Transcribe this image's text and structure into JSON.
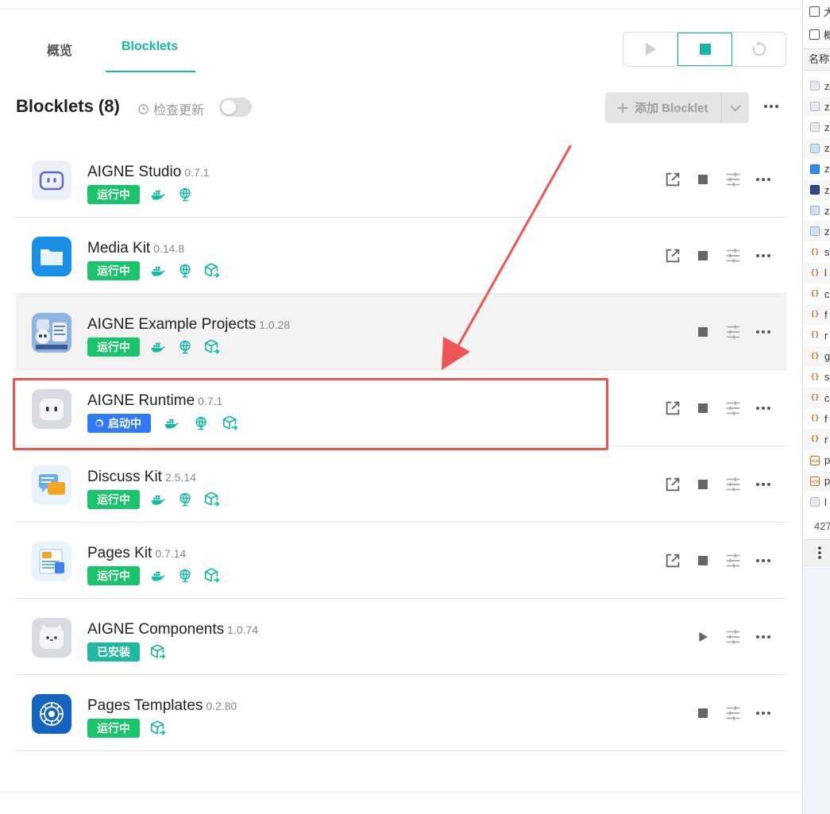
{
  "tabs": [
    {
      "label": "概览",
      "active": false
    },
    {
      "label": "Blocklets",
      "active": true
    }
  ],
  "header": {
    "title": "Blocklets (8)",
    "check_update": "检查更新",
    "add_button": "添加 Blocklet"
  },
  "colors": {
    "accent": "#14b8a6",
    "running": "#1ac46a",
    "starting": "#2f7bf5",
    "installed": "#1fb8a0",
    "highlight": "#ef5454"
  },
  "blocklets": [
    {
      "name": "AIGNE Studio",
      "version": "0.7.1",
      "status": "运行中",
      "status_type": "running",
      "icons": [
        "docker-icon",
        "globe-icon"
      ],
      "actions": [
        "open",
        "stop",
        "settings",
        "more"
      ],
      "logo": "aigne-studio"
    },
    {
      "name": "Media Kit",
      "version": "0.14.8",
      "status": "运行中",
      "status_type": "running",
      "icons": [
        "docker-icon",
        "globe-icon",
        "package-icon"
      ],
      "actions": [
        "open",
        "stop",
        "settings",
        "more"
      ],
      "logo": "media-kit"
    },
    {
      "name": "AIGNE Example Projects",
      "version": "1.0.28",
      "status": "运行中",
      "status_type": "running",
      "icons": [
        "docker-icon",
        "globe-icon",
        "package-icon"
      ],
      "actions": [
        "stop",
        "settings",
        "more"
      ],
      "logo": "example-projects"
    },
    {
      "name": "AIGNE Runtime",
      "version": "0.7.1",
      "status": "启动中",
      "status_type": "starting",
      "icons": [
        "docker-icon",
        "globe-icon",
        "package-icon"
      ],
      "actions": [
        "open",
        "stop",
        "settings",
        "more"
      ],
      "logo": "aigne-runtime"
    },
    {
      "name": "Discuss Kit",
      "version": "2.5.14",
      "status": "运行中",
      "status_type": "running",
      "icons": [
        "docker-icon",
        "globe-icon",
        "package-icon"
      ],
      "actions": [
        "open",
        "stop",
        "settings",
        "more"
      ],
      "logo": "discuss-kit"
    },
    {
      "name": "Pages Kit",
      "version": "0.7.14",
      "status": "运行中",
      "status_type": "running",
      "icons": [
        "docker-icon",
        "globe-icon",
        "package-icon"
      ],
      "actions": [
        "open",
        "stop",
        "settings",
        "more"
      ],
      "logo": "pages-kit"
    },
    {
      "name": "AIGNE Components",
      "version": "1.0.74",
      "status": "已安装",
      "status_type": "installed",
      "icons": [
        "package-icon"
      ],
      "actions": [
        "start",
        "settings",
        "more"
      ],
      "logo": "aigne-components"
    },
    {
      "name": "Pages Templates",
      "version": "0.2.80",
      "status": "运行中",
      "status_type": "running",
      "icons": [
        "package-icon"
      ],
      "actions": [
        "stop",
        "settings",
        "more"
      ],
      "logo": "pages-templates"
    }
  ],
  "right_panel": {
    "checkbox_labels": [
      "大",
      "概"
    ],
    "column_header": "名称",
    "files": [
      {
        "icon": "doc",
        "label": "z"
      },
      {
        "icon": "doc",
        "label": "z"
      },
      {
        "icon": "doc",
        "label": "z"
      },
      {
        "icon": "img",
        "label": "z"
      },
      {
        "icon": "blue",
        "label": "z"
      },
      {
        "icon": "dark",
        "label": "z"
      },
      {
        "icon": "img",
        "label": "z"
      },
      {
        "icon": "img",
        "label": "z"
      },
      {
        "icon": "js",
        "label": "s"
      },
      {
        "icon": "js",
        "label": "l"
      },
      {
        "icon": "js",
        "label": "c"
      },
      {
        "icon": "js",
        "label": "f"
      },
      {
        "icon": "js",
        "label": "r"
      },
      {
        "icon": "js",
        "label": "g"
      },
      {
        "icon": "js",
        "label": "s"
      },
      {
        "icon": "js",
        "label": "c"
      },
      {
        "icon": "js",
        "label": "f"
      },
      {
        "icon": "js",
        "label": "r"
      },
      {
        "icon": "sq",
        "label": "p"
      },
      {
        "icon": "sq",
        "label": "p"
      },
      {
        "icon": "doc",
        "label": "l"
      }
    ],
    "count": "427"
  }
}
